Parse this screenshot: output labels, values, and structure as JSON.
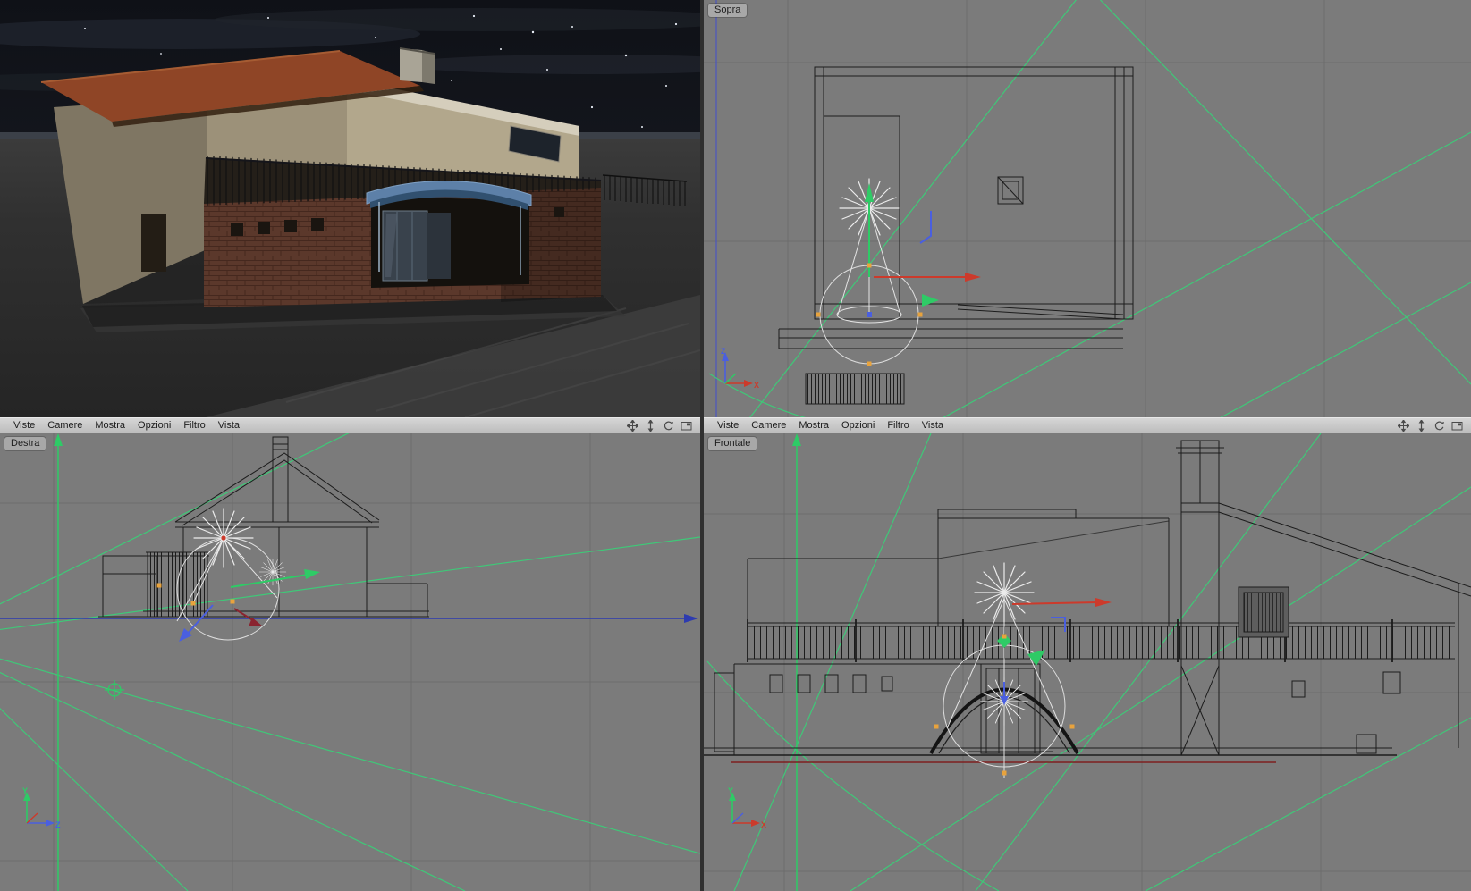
{
  "app": {
    "title": "3D quad-view editor (Italian locale), night house scene"
  },
  "colors": {
    "viewport_bg": "#7b7b7b",
    "grid_line": "#6d6d6d",
    "wireframe": "#1c1c1c",
    "frustum_green": "#3fc878",
    "axis_x_red": "#cc3a2b",
    "axis_y_green": "#2ecb66",
    "axis_z_blue": "#4a5fe0",
    "handle_orange": "#e8a33d",
    "menu_bg": "#c9c9c9",
    "menu_text": "#1c1c1c",
    "label_badge_bg": "#a8a8a8",
    "night_sky": "#15171d",
    "roof_terracotta": "#8f4526",
    "awning_blue": "#5d80a8",
    "brick": "#5b382b"
  },
  "menubar": {
    "items": [
      {
        "label": "Viste"
      },
      {
        "label": "Camere"
      },
      {
        "label": "Mostra"
      },
      {
        "label": "Opzioni"
      },
      {
        "label": "Filtro"
      },
      {
        "label": "Vista"
      }
    ],
    "icons": [
      {
        "name": "pan-icon"
      },
      {
        "name": "zoom-icon"
      },
      {
        "name": "rotate-icon"
      },
      {
        "name": "layout-toggle-icon"
      }
    ]
  },
  "viewports": {
    "perspective": {
      "label": "",
      "type": "rendered perspective view"
    },
    "top": {
      "label": "Sopra",
      "axis_vertical": "Z",
      "axis_horizontal": "X"
    },
    "right": {
      "label": "Destra",
      "axis_vertical": "Y",
      "axis_horizontal": "Z"
    },
    "front": {
      "label": "Frontale",
      "axis_vertical": "Y",
      "axis_horizontal": "X"
    }
  }
}
